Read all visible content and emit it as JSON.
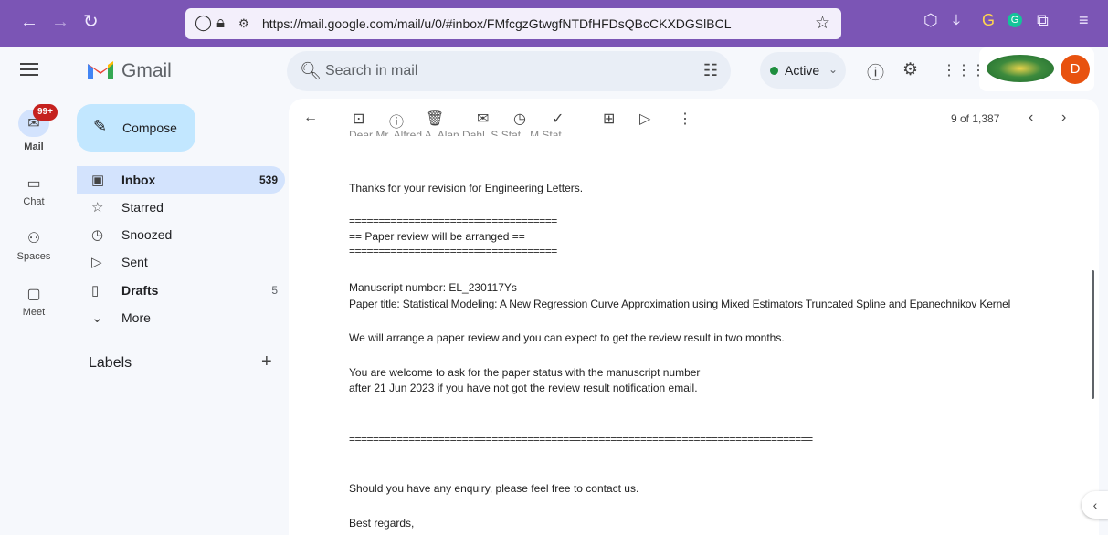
{
  "browser": {
    "url": "https://mail.google.com/mail/u/0/#inbox/FMfcgzGtwgfNTDfHFDsQBcCKXDGSlBCL",
    "back": "←",
    "forward": "→",
    "reload": "↻"
  },
  "header": {
    "app_name": "Gmail",
    "search_placeholder": "Search in mail",
    "status_label": "Active",
    "avatar_initial": "D",
    "colors": {
      "accent": "#c2e7ff",
      "status": "#1e8e3e",
      "avatar": "#e8520f"
    }
  },
  "rail": {
    "mail": "Mail",
    "mail_badge": "99+",
    "chat": "Chat",
    "spaces": "Spaces",
    "meet": "Meet"
  },
  "sidebar": {
    "compose": "Compose",
    "items": [
      {
        "label": "Inbox",
        "count": "539",
        "icon": "inbox-icon"
      },
      {
        "label": "Starred",
        "count": "",
        "icon": "star-icon"
      },
      {
        "label": "Snoozed",
        "count": "",
        "icon": "clock-icon"
      },
      {
        "label": "Sent",
        "count": "",
        "icon": "send-icon"
      },
      {
        "label": "Drafts",
        "count": "5",
        "icon": "draft-icon"
      },
      {
        "label": "More",
        "count": "",
        "icon": "chevron-down-icon"
      }
    ],
    "labels_heading": "Labels"
  },
  "toolbar": {
    "pager": "9 of 1,387"
  },
  "email": {
    "lines": [
      "Thanks for your revision for Engineering Letters.",
      "===================================",
      "== Paper review will be arranged ==",
      "===================================",
      "Manuscript number: EL_230117Ys",
      "Paper title: Statistical Modeling: A New Regression Curve Approximation using Mixed Estimators Truncated Spline and Epanechnikov Kernel",
      "We will arrange a paper review and you can expect to get the review result in two months.",
      "You are welcome to ask for the paper status with the manuscript number",
      "after 21 Jun 2023 if you have not got the review result notification email.",
      "==============================================================================",
      "Should you have any enquiry, please feel free to contact us.",
      "Best regards,"
    ]
  }
}
